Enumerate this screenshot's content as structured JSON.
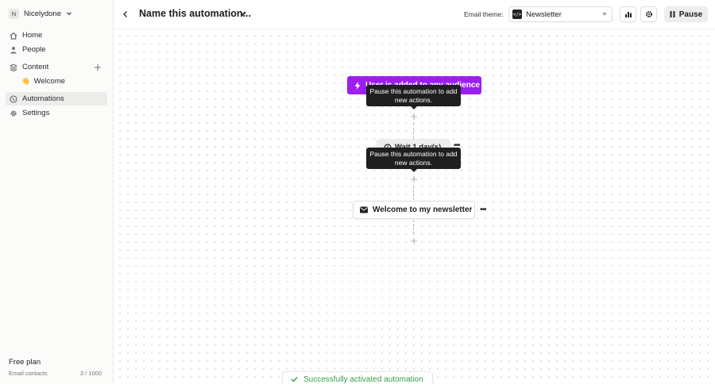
{
  "workspace": {
    "avatar_letter": "N",
    "name": "Nicelydone"
  },
  "sidebar": {
    "items": [
      {
        "label": "Home",
        "icon": "home-icon"
      },
      {
        "label": "People",
        "icon": "person-icon"
      },
      {
        "label": "Content",
        "icon": "content-icon"
      },
      {
        "label": "Automations",
        "icon": "automation-icon",
        "active": true
      },
      {
        "label": "Settings",
        "icon": "gear-icon"
      }
    ],
    "sub_item": {
      "emoji": "👋",
      "label": "Welcome"
    },
    "plan": {
      "label": "Free plan",
      "contacts_label": "Email contacts",
      "contacts_value": "3 / 1000"
    }
  },
  "header": {
    "title": "Name this automation...",
    "theme_label": "Email theme:",
    "theme_value": "Newsletter",
    "theme_icon_glyph": "</>",
    "pause_label": "Pause"
  },
  "flow": {
    "trigger_label": "User is added to any audience",
    "wait_label": "Wait 1 day(s)",
    "email_label": "Welcome to my newsletter",
    "more_glyph": "•••",
    "tooltip_text": "Pause this automation to add new actions."
  },
  "toast": {
    "text": "Successfully activated automation"
  },
  "colors": {
    "accent": "#9a1ff0",
    "success": "#3a9d4a"
  }
}
